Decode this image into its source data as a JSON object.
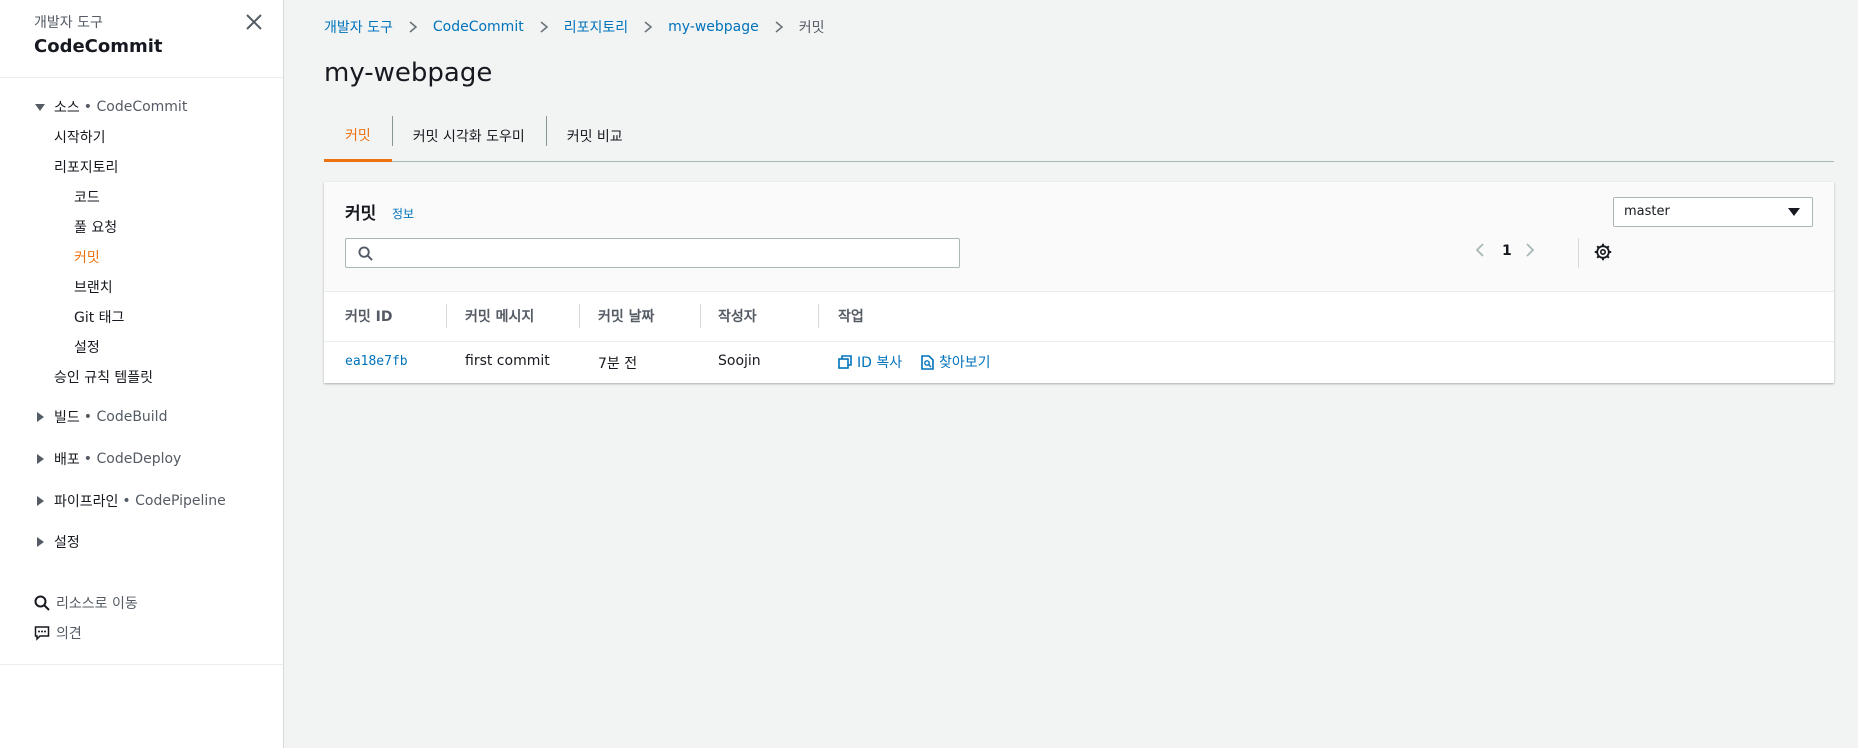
{
  "sidebar": {
    "kicker": "개발자 도구",
    "service": "CodeCommit",
    "sections": [
      {
        "label": "소스",
        "sub": "• CodeCommit"
      },
      {
        "label": "빌드",
        "sub": "• CodeBuild"
      },
      {
        "label": "배포",
        "sub": "• CodeDeploy"
      },
      {
        "label": "파이프라인",
        "sub": "• CodePipeline"
      },
      {
        "label": "설정",
        "sub": ""
      }
    ],
    "items": [
      {
        "label": "시작하기"
      },
      {
        "label": "리포지토리"
      },
      {
        "label": "코드"
      },
      {
        "label": "풀 요청"
      },
      {
        "label": "커밋"
      },
      {
        "label": "브랜치"
      },
      {
        "label": "Git 태그"
      },
      {
        "label": "설정"
      },
      {
        "label": "승인 규칙 템플릿"
      }
    ],
    "utilities": [
      {
        "label": "리소스로 이동",
        "icon": "search-icon"
      },
      {
        "label": "의견",
        "icon": "feedback-icon"
      }
    ]
  },
  "breadcrumb": {
    "items": [
      "개발자 도구",
      "CodeCommit",
      "리포지토리",
      "my-webpage"
    ],
    "current": "커밋"
  },
  "page": {
    "title": "my-webpage"
  },
  "tabs": [
    {
      "label": "커밋"
    },
    {
      "label": "커밋 시각화 도우미"
    },
    {
      "label": "커밋 비교"
    }
  ],
  "panel": {
    "title": "커밋",
    "info": "정보",
    "search_value": "",
    "branch": "master",
    "page": "1"
  },
  "table": {
    "headers": [
      "커밋 ID",
      "커밋 메시지",
      "커밋 날짜",
      "작성자",
      "작업"
    ],
    "rows": [
      {
        "id": "ea18e7fb",
        "message": "first commit",
        "date": "7분 전",
        "author": "Soojin",
        "actions": [
          "ID 복사",
          "찾아보기"
        ]
      }
    ]
  },
  "colors": {
    "accent": "#ec7211",
    "link": "#0073bb",
    "background": "#f2f3f3"
  }
}
